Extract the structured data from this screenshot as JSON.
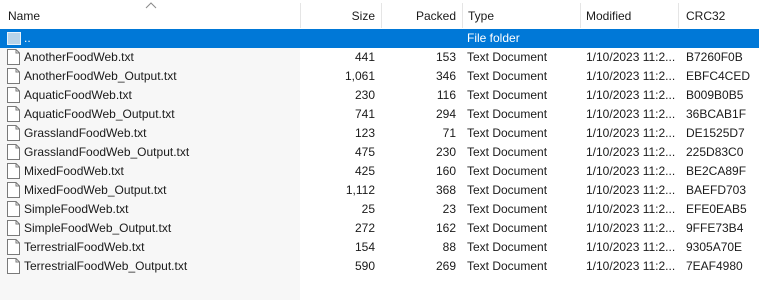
{
  "columns": {
    "name": "Name",
    "size": "Size",
    "packed": "Packed",
    "type": "Type",
    "modified": "Modified",
    "crc": "CRC32"
  },
  "colors": {
    "selection": "#0078d7",
    "selection_text": "#ffffff",
    "name_column_bg": "#f7f7f7"
  },
  "parent_row": {
    "name": "..",
    "type": "File folder"
  },
  "files": [
    {
      "name": "AnotherFoodWeb.txt",
      "size": "441",
      "packed": "153",
      "type": "Text Document",
      "modified": "1/10/2023 11:2...",
      "crc": "B7260F0B"
    },
    {
      "name": "AnotherFoodWeb_Output.txt",
      "size": "1,061",
      "packed": "346",
      "type": "Text Document",
      "modified": "1/10/2023 11:2...",
      "crc": "EBFC4CED"
    },
    {
      "name": "AquaticFoodWeb.txt",
      "size": "230",
      "packed": "116",
      "type": "Text Document",
      "modified": "1/10/2023 11:2...",
      "crc": "B009B0B5"
    },
    {
      "name": "AquaticFoodWeb_Output.txt",
      "size": "741",
      "packed": "294",
      "type": "Text Document",
      "modified": "1/10/2023 11:2...",
      "crc": "36BCAB1F"
    },
    {
      "name": "GrasslandFoodWeb.txt",
      "size": "123",
      "packed": "71",
      "type": "Text Document",
      "modified": "1/10/2023 11:2...",
      "crc": "DE1525D7"
    },
    {
      "name": "GrasslandFoodWeb_Output.txt",
      "size": "475",
      "packed": "230",
      "type": "Text Document",
      "modified": "1/10/2023 11:2...",
      "crc": "225D83C0"
    },
    {
      "name": "MixedFoodWeb.txt",
      "size": "425",
      "packed": "160",
      "type": "Text Document",
      "modified": "1/10/2023 11:2...",
      "crc": "BE2CA89F"
    },
    {
      "name": "MixedFoodWeb_Output.txt",
      "size": "1,112",
      "packed": "368",
      "type": "Text Document",
      "modified": "1/10/2023 11:2...",
      "crc": "BAEFD703"
    },
    {
      "name": "SimpleFoodWeb.txt",
      "size": "25",
      "packed": "23",
      "type": "Text Document",
      "modified": "1/10/2023 11:2...",
      "crc": "EFE0EAB5"
    },
    {
      "name": "SimpleFoodWeb_Output.txt",
      "size": "272",
      "packed": "162",
      "type": "Text Document",
      "modified": "1/10/2023 11:2...",
      "crc": "9FFE73B4"
    },
    {
      "name": "TerrestrialFoodWeb.txt",
      "size": "154",
      "packed": "88",
      "type": "Text Document",
      "modified": "1/10/2023 11:2...",
      "crc": "9305A70E"
    },
    {
      "name": "TerrestrialFoodWeb_Output.txt",
      "size": "590",
      "packed": "269",
      "type": "Text Document",
      "modified": "1/10/2023 11:2...",
      "crc": "7EAF4980"
    }
  ]
}
